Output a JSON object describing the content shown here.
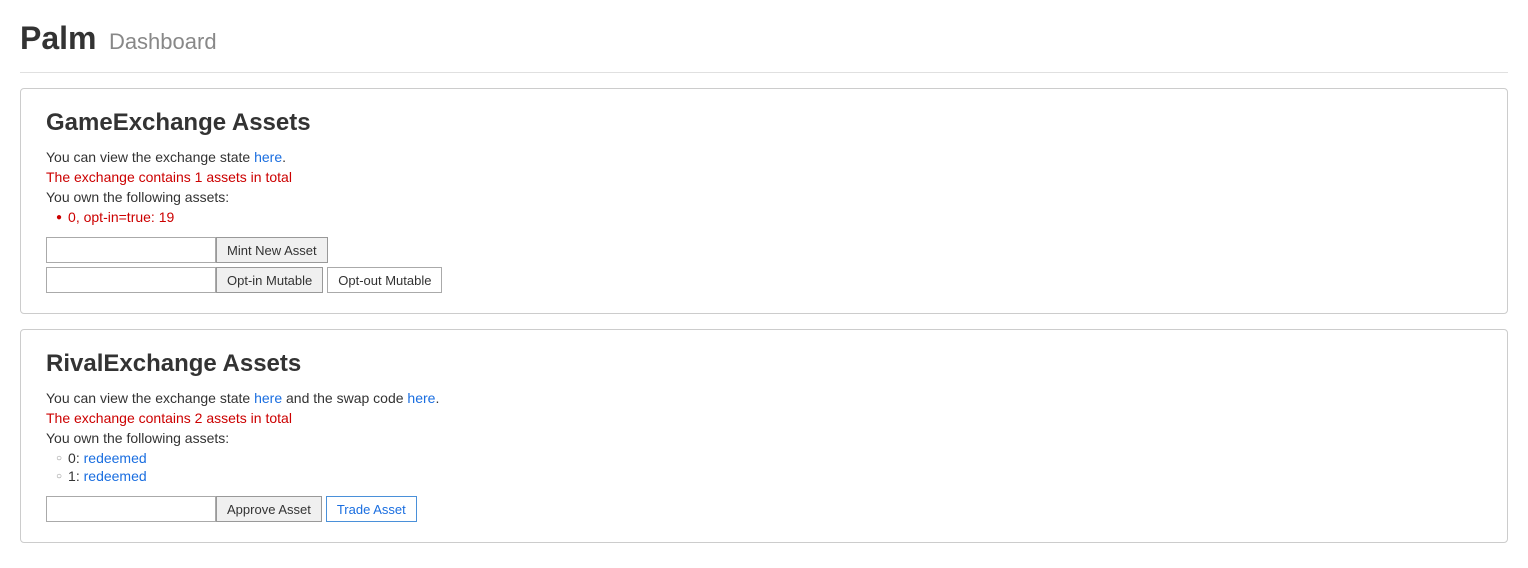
{
  "header": {
    "title_bold": "Palm",
    "title_regular": "Dashboard"
  },
  "game_exchange": {
    "title": "GameExchange Assets",
    "view_state_prefix": "You can view the exchange state",
    "view_state_link": "here",
    "view_state_link_href": "#",
    "total_assets_text": "The exchange contains 1 assets in total",
    "owned_prefix": "You own the following assets:",
    "owned_assets": [
      {
        "label": "0, opt-in=true: 19"
      }
    ],
    "mint_input_placeholder": "",
    "mint_button": "Mint New Asset",
    "optin_button": "Opt-in Mutable",
    "optout_button": "Opt-out Mutable"
  },
  "rival_exchange": {
    "title": "RivalExchange Assets",
    "view_state_prefix": "You can view the exchange state",
    "view_state_link": "here",
    "view_state_and": "and the swap code",
    "view_state_link2": "here",
    "total_assets_text": "The exchange contains 2 assets in total",
    "owned_prefix": "You own the following assets:",
    "owned_assets": [
      {
        "label": "0:",
        "status": "redeemed"
      },
      {
        "label": "1:",
        "status": "redeemed"
      }
    ],
    "approve_input_placeholder": "",
    "approve_button": "Approve Asset",
    "trade_button": "Trade Asset"
  }
}
